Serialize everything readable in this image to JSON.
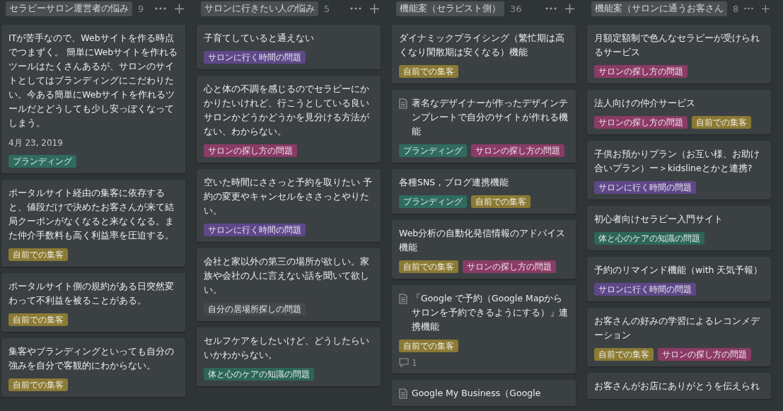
{
  "columns": [
    {
      "title": "セラピーサロン運営者の悩み",
      "count": "9",
      "cards": [
        {
          "page_icon": false,
          "text": "ITが苦手なので、Webサイトを作る時点でつまずく。 簡単にWebサイトを作れるツールはたくさんあるが、サロンのサイトとしてはブランディングにこだわりたい。今ある簡単にWebサイトを作れるツールだとどうしても少し安っぽくなってしまう。",
          "date": "4月 23, 2019",
          "tags": [
            {
              "label": "ブランディング",
              "color": "#2f6b5f"
            }
          ]
        },
        {
          "page_icon": false,
          "text": "ポータルサイト経由の集客に依存すると、値段だけで決めたお客さんが来て結局クーポンがなくなると来なくなる。また仲介手数料も高く利益率を圧迫する。",
          "tags": [
            {
              "label": "自前での集客",
              "color": "#8b7a34"
            }
          ]
        },
        {
          "page_icon": false,
          "text": "ポータルサイト側の規約がある日突然変わって不利益を被ることがある。",
          "tags": [
            {
              "label": "自前での集客",
              "color": "#8b7a34"
            }
          ]
        },
        {
          "page_icon": false,
          "text": "集客やブランディングといっても自分の強みを自分で客観的にわからない。",
          "tags": [
            {
              "label": "自前での集客",
              "color": "#8b7a34"
            }
          ]
        }
      ]
    },
    {
      "title": "サロンに行きたい人の悩み",
      "count": "5",
      "cards": [
        {
          "page_icon": false,
          "text": "子育てしていると通えない",
          "tags": [
            {
              "label": "サロンに行く時間の問題",
              "color": "#5e4888"
            }
          ]
        },
        {
          "page_icon": false,
          "text": "心と体の不調を感じるのでセラピーにかかりたいけれど、行こうとしている良いサロンかどうかどうかを見分ける方法がない、わからない。",
          "tags": [
            {
              "label": "サロンの探し方の問題",
              "color": "#8a3b66"
            }
          ]
        },
        {
          "page_icon": false,
          "text": "空いた時間にささっと予約を取りたい 予約の変更やキャンセルをささっとやりたい。",
          "tags": [
            {
              "label": "サロンに行く時間の問題",
              "color": "#5e4888"
            }
          ]
        },
        {
          "page_icon": false,
          "text": "会社と家以外の第三の場所が欲しい。家族や会社の人に言えない話を聞いて欲しい。",
          "tags": [
            {
              "label": "自分の居場所探しの問題",
              "color": "#46494c"
            }
          ]
        },
        {
          "page_icon": false,
          "text": "セルフケアをしたいけど、どうしたらいいかわからない。",
          "tags": [
            {
              "label": "体と心のケアの知識の問題",
              "color": "#2d6657"
            }
          ]
        }
      ]
    },
    {
      "title": "機能案（セラピスト側）",
      "count": "36",
      "cards": [
        {
          "page_icon": false,
          "text": "ダイナミックプライシング（繁忙期は高くなり閑散期は安くなる）機能",
          "tags": [
            {
              "label": "自前での集客",
              "color": "#8b7a34"
            }
          ]
        },
        {
          "page_icon": true,
          "text": "著名なデザイナーが作ったデザインテンプレートで自分のサイトが作れる機能",
          "tags": [
            {
              "label": "ブランディング",
              "color": "#2f6b5f"
            },
            {
              "label": "サロンの探し方の問題",
              "color": "#8a3b66"
            }
          ]
        },
        {
          "page_icon": false,
          "text": "各種SNS，ブログ連携機能",
          "tags": [
            {
              "label": "ブランディング",
              "color": "#2f6b5f"
            },
            {
              "label": "自前での集客",
              "color": "#8b7a34"
            }
          ]
        },
        {
          "page_icon": false,
          "text": "Web分析の自動化発信情報のアドバイス機能",
          "tags": [
            {
              "label": "自前での集客",
              "color": "#8b7a34"
            },
            {
              "label": "サロンの探し方の問題",
              "color": "#8a3b66"
            }
          ]
        },
        {
          "page_icon": true,
          "text": "「Google で予約（Google Mapからサロンを予約できるようにする）」連携機能",
          "tags": [
            {
              "label": "自前での集客",
              "color": "#8b7a34"
            }
          ],
          "comments": "1"
        },
        {
          "page_icon": true,
          "text": "Google My Business（Google"
        }
      ]
    },
    {
      "title": "機能案（サロンに通うお客さん",
      "count": "8",
      "cards": [
        {
          "page_icon": false,
          "text": "月額定額制で色んなセラピーが受けられるサービス",
          "tags": [
            {
              "label": "サロンの探し方の問題",
              "color": "#8a3b66"
            }
          ]
        },
        {
          "page_icon": false,
          "text": "法人向けの仲介サービス",
          "tags": [
            {
              "label": "サロンの探し方の問題",
              "color": "#8a3b66"
            },
            {
              "label": "自前での集客",
              "color": "#8b7a34"
            }
          ]
        },
        {
          "page_icon": false,
          "text": "子供お預かりプラン（お互い様、お助け合いプラン）ー＞kidslineとかと連携?",
          "tags": [
            {
              "label": "サロンに行く時間の問題",
              "color": "#5e4888"
            }
          ]
        },
        {
          "page_icon": false,
          "text": "初心者向けセラピー入門サイト",
          "tags": [
            {
              "label": "体と心のケアの知識の問題",
              "color": "#2d6657"
            }
          ]
        },
        {
          "page_icon": false,
          "text": "予約のリマインド機能（with 天気予報）",
          "tags": [
            {
              "label": "サロンに行く時間の問題",
              "color": "#5e4888"
            }
          ]
        },
        {
          "page_icon": false,
          "text": "お客さんの好みの学習によるレコンメデーション",
          "tags": [
            {
              "label": "自前での集客",
              "color": "#8b7a34"
            },
            {
              "label": "サロンの探し方の問題",
              "color": "#8a3b66"
            }
          ]
        },
        {
          "page_icon": false,
          "text": "お客さんがお店にありがとうを伝えられ"
        }
      ]
    }
  ]
}
